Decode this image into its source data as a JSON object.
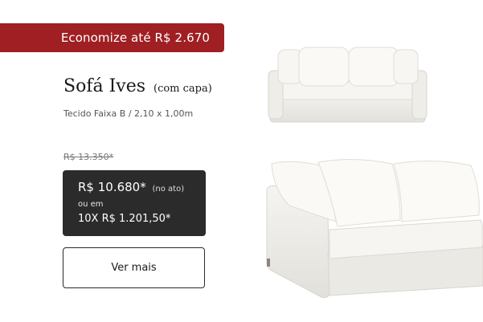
{
  "promo": {
    "text": "Economize até R$ 2.670"
  },
  "product": {
    "name": "Sofá Ives",
    "name_suffix": "(com capa)",
    "spec": "Tecido Faixa B / 2,10 x 1,00m"
  },
  "pricing": {
    "old_price": "R$ 13.350*",
    "price": "R$ 10.680*",
    "price_note": "(no ato)",
    "or_label": "ou em",
    "installments": "10X R$ 1.201,50*"
  },
  "cta": {
    "label": "Ver mais"
  },
  "colors": {
    "promo": "#a01f23",
    "price_box": "#2b2b2b",
    "button_border": "#2a2a2a"
  },
  "images": [
    {
      "name": "sofa-front-view"
    },
    {
      "name": "sofa-angled-view"
    }
  ]
}
